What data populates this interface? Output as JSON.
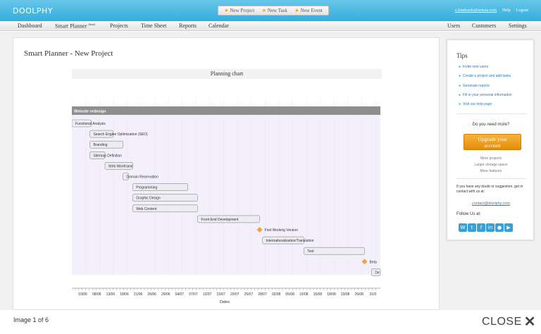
{
  "app": {
    "logo": "DOOLPHY"
  },
  "quick_actions": [
    {
      "label": "New Project"
    },
    {
      "label": "New Task"
    },
    {
      "label": "New Event"
    }
  ],
  "top_right": {
    "user": "z.lombardo@sensia.com",
    "help": "Help",
    "logout": "Logout"
  },
  "nav": {
    "left": [
      {
        "label": "Dashboard"
      },
      {
        "label": "Smart Planner",
        "badge": "(beta)"
      },
      {
        "label": "Projects"
      },
      {
        "label": "Time Sheet"
      },
      {
        "label": "Reports"
      },
      {
        "label": "Calendar"
      }
    ],
    "right": [
      {
        "label": "Users"
      },
      {
        "label": "Customers"
      },
      {
        "label": "Settings"
      }
    ]
  },
  "page": {
    "title": "Smart Planner - New Project"
  },
  "chart_data": {
    "type": "gantt",
    "title": "Planning chart",
    "xlabel": "Dates",
    "x_ticks": [
      "03/06",
      "08/06",
      "13/06",
      "18/06",
      "21/06",
      "26/06",
      "29/06",
      "04/07",
      "07/07",
      "12/07",
      "15/07",
      "20/07",
      "25/07",
      "28/07",
      "02/08",
      "05/08",
      "10/08",
      "15/08",
      "18/08",
      "23/08",
      "26/08",
      "31/0"
    ],
    "project": "Website redesign",
    "tasks": [
      {
        "name": "Functional Analysis",
        "start": 0.0,
        "end": 1.4,
        "type": "task"
      },
      {
        "name": "Search Engine Optimization (SEO)",
        "start": 1.3,
        "end": 3.0,
        "type": "task"
      },
      {
        "name": "Branding",
        "start": 1.3,
        "end": 3.7,
        "type": "task"
      },
      {
        "name": "Sitemap Definition",
        "start": 1.3,
        "end": 2.4,
        "type": "task"
      },
      {
        "name": "Web Wireframe",
        "start": 2.4,
        "end": 4.4,
        "type": "task"
      },
      {
        "name": "Domain Reservation",
        "start": 3.7,
        "end": 4.1,
        "type": "task"
      },
      {
        "name": "Programming",
        "start": 4.4,
        "end": 8.4,
        "type": "task"
      },
      {
        "name": "Graphic Design",
        "start": 4.4,
        "end": 9.1,
        "type": "task"
      },
      {
        "name": "Web Content",
        "start": 4.4,
        "end": 9.1,
        "type": "task"
      },
      {
        "name": "Front-End Development",
        "start": 9.1,
        "end": 13.6,
        "type": "task"
      },
      {
        "name": "First Working Version",
        "start": 13.6,
        "type": "milestone"
      },
      {
        "name": "Internationalization/Translation",
        "start": 13.8,
        "end": 16.8,
        "type": "task"
      },
      {
        "name": "Test",
        "start": 16.8,
        "end": 21.2,
        "type": "task"
      },
      {
        "name": "Beta",
        "start": 21.2,
        "type": "milestone"
      },
      {
        "name": "De",
        "start": 21.7,
        "end": 22.5,
        "type": "task"
      }
    ],
    "colors": {
      "header": "#8e8e8e",
      "task": "#ececf2",
      "milestone": "#f2a23a",
      "bg": "#f3f0fb"
    }
  },
  "tips": {
    "title": "Tips",
    "links": [
      "Invite new users",
      "Create a project and add tasks",
      "Generate reports",
      "Fill in your personal information",
      "Visit our help page"
    ],
    "need_more": "Do you need more?",
    "upgrade_line1": "Upgrade your",
    "upgrade_line2": "account",
    "perks": [
      "More projects",
      "Larger storage space",
      "More features"
    ],
    "doubt": "If you have any doubt or suggestion, get in contact with us at:",
    "contact": "contact@doolphy.com",
    "follow": "Follow Us at:",
    "social": [
      "wordpress-icon",
      "twitter-icon",
      "facebook-icon",
      "linkedin-icon",
      "flickr-icon",
      "youtube-icon"
    ]
  },
  "lightbox": {
    "counter": "Image 1 of 6",
    "close": "CLOSE"
  }
}
